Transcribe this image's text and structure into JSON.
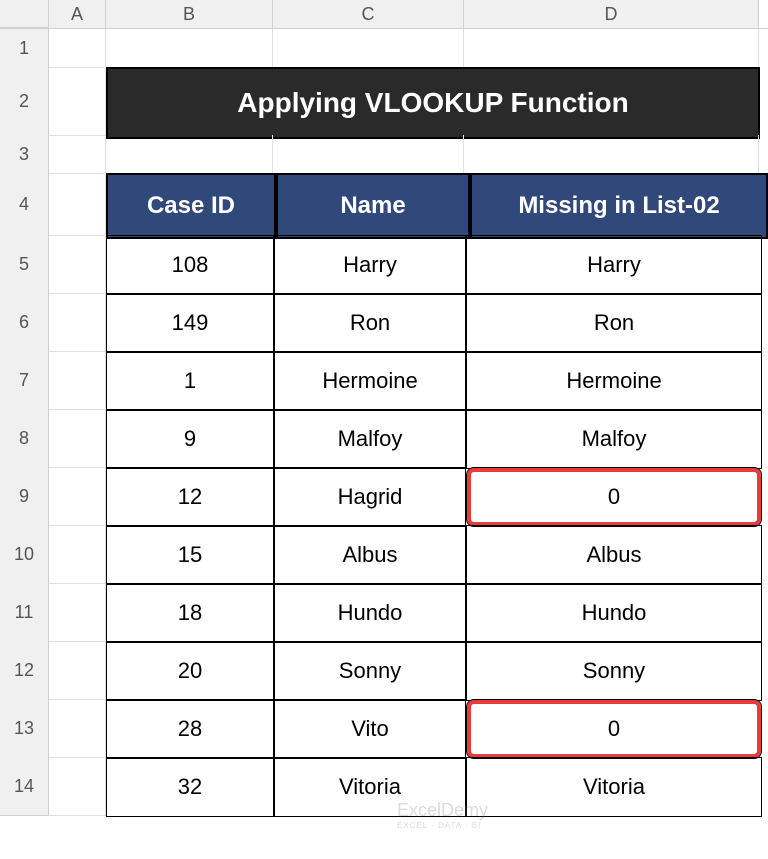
{
  "columns": [
    "A",
    "B",
    "C",
    "D"
  ],
  "rowNumbers": [
    "1",
    "2",
    "3",
    "4",
    "5",
    "6",
    "7",
    "8",
    "9",
    "10",
    "11",
    "12",
    "13",
    "14"
  ],
  "title": "Applying VLOOKUP Function",
  "headers": {
    "caseId": "Case ID",
    "name": "Name",
    "missing": "Missing in List-02"
  },
  "rows": [
    {
      "caseId": "108",
      "name": "Harry",
      "missing": "Harry",
      "hl": false
    },
    {
      "caseId": "149",
      "name": "Ron",
      "missing": "Ron",
      "hl": false
    },
    {
      "caseId": "1",
      "name": "Hermoine",
      "missing": "Hermoine",
      "hl": false
    },
    {
      "caseId": "9",
      "name": "Malfoy",
      "missing": "Malfoy",
      "hl": false
    },
    {
      "caseId": "12",
      "name": "Hagrid",
      "missing": "0",
      "hl": true
    },
    {
      "caseId": "15",
      "name": "Albus",
      "missing": "Albus",
      "hl": false
    },
    {
      "caseId": "18",
      "name": "Hundo",
      "missing": "Hundo",
      "hl": false
    },
    {
      "caseId": "20",
      "name": "Sonny",
      "missing": "Sonny",
      "hl": false
    },
    {
      "caseId": "28",
      "name": "Vito",
      "missing": "0",
      "hl": true
    },
    {
      "caseId": "32",
      "name": "Vitoria",
      "missing": "Vitoria",
      "hl": false
    }
  ],
  "watermark": {
    "brand": "ExcelDemy",
    "tag": "EXCEL · DATA · BI"
  },
  "chart_data": {
    "type": "table",
    "title": "Applying VLOOKUP Function",
    "columns": [
      "Case ID",
      "Name",
      "Missing in List-02"
    ],
    "rows": [
      [
        "108",
        "Harry",
        "Harry"
      ],
      [
        "149",
        "Ron",
        "Ron"
      ],
      [
        "1",
        "Hermoine",
        "Hermoine"
      ],
      [
        "9",
        "Malfoy",
        "Malfoy"
      ],
      [
        "12",
        "Hagrid",
        "0"
      ],
      [
        "15",
        "Albus",
        "Albus"
      ],
      [
        "18",
        "Hundo",
        "Hundo"
      ],
      [
        "20",
        "Sonny",
        "Sonny"
      ],
      [
        "28",
        "Vito",
        "0"
      ],
      [
        "32",
        "Vitoria",
        "Vitoria"
      ]
    ]
  }
}
